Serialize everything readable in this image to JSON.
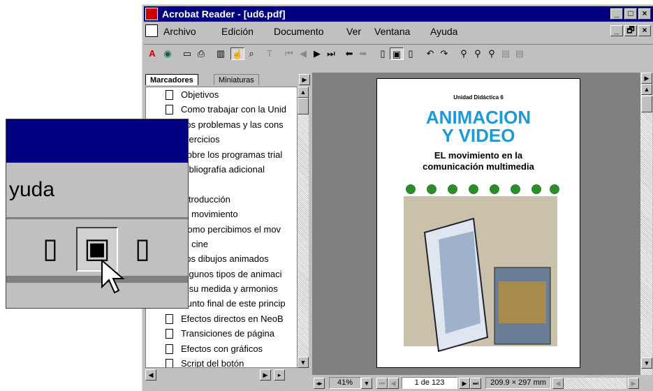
{
  "window": {
    "title": "Acrobat Reader - [ud6.pdf]",
    "controls": [
      "_",
      "□",
      "×"
    ],
    "doc_controls": [
      "_",
      "🗗",
      "×"
    ]
  },
  "menu": [
    "Archivo",
    "Edición",
    "Documento",
    "Ver",
    "Ventana",
    "Ayuda"
  ],
  "panel": {
    "tab_active": "Marcadores",
    "tab_inactive": "Miniaturas",
    "bookmarks": [
      "Objetivos",
      "Como trabajar con la Unid",
      "Los problemas y las cons",
      "Ejercicios",
      "Sobre los programas trial",
      "Bibliografía adicional",
      "",
      "Introducción",
      "El movimiento",
      "Como percibimos el mov",
      "El cine",
      "Los dibujos animados",
      "Algunos tipos de animaci",
      "A su medida y armonios",
      "Punto final de este princip",
      "Efectos directos en NeoB",
      "Transiciones de página",
      "Efectos con gráficos",
      "Script del botón"
    ]
  },
  "page": {
    "kicker": "Unidad Didáctica 6",
    "title_line1": "ANIMACION",
    "title_line2": "Y VIDEO",
    "subtitle_line1": "EL movimiento en la",
    "subtitle_line2": "comunicación multimedia"
  },
  "status": {
    "zoom": "41%",
    "page_indicator": "1 de 123",
    "page_size": "209.9 × 297  mm"
  },
  "zoom_inset": {
    "menu_fragment": "yuda"
  },
  "colors": {
    "titlebar": "#000080",
    "title_text": "#1a9bd7"
  }
}
